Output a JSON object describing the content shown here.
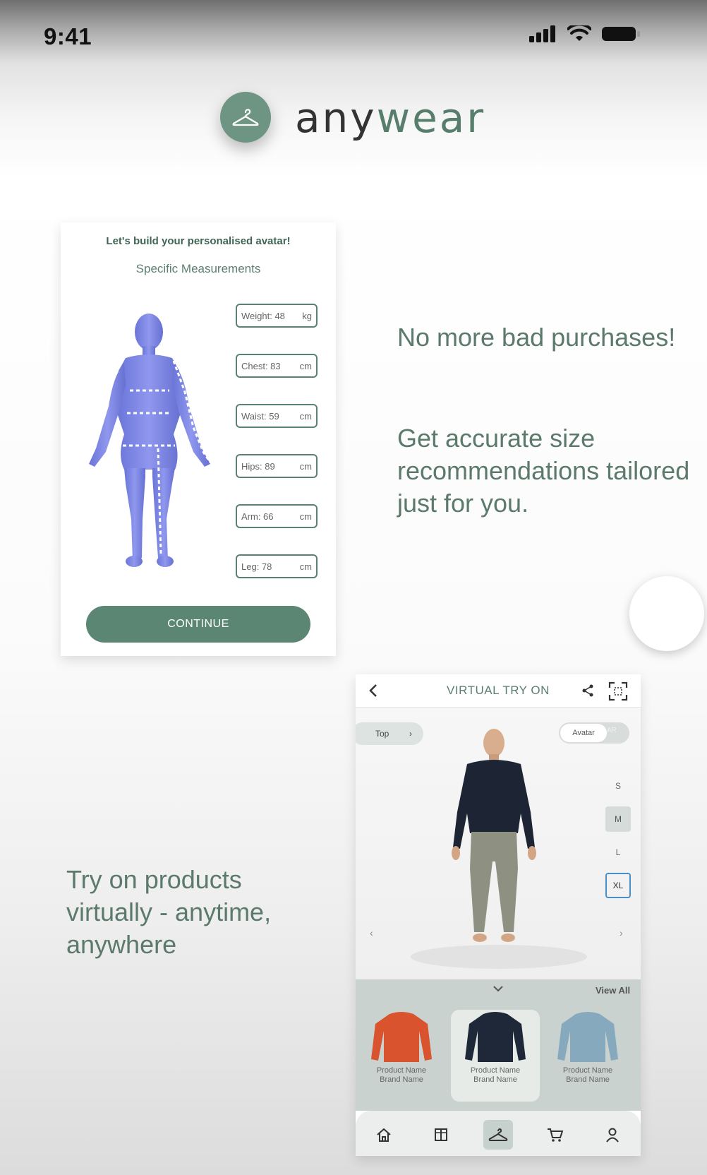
{
  "status_bar": {
    "time": "9:41"
  },
  "brand": {
    "prefix": "any",
    "accent": "wear"
  },
  "avatar_card": {
    "title": "Let's build your personalised avatar!",
    "subtitle": "Specific Measurements",
    "measurements": [
      {
        "label": "Weight: 48",
        "unit": "kg"
      },
      {
        "label": "Chest: 83",
        "unit": "cm"
      },
      {
        "label": "Waist: 59",
        "unit": "cm"
      },
      {
        "label": "Hips: 89",
        "unit": "cm"
      },
      {
        "label": "Arm: 66",
        "unit": "cm"
      },
      {
        "label": "Leg: 78",
        "unit": "cm"
      }
    ],
    "continue_label": "CONTINUE"
  },
  "promo": {
    "line1": "No more bad purchases!",
    "line2": "Get accurate size recommendations tailored just for you.",
    "line3": "Try on products virtually - anytime, anywhere"
  },
  "try_on": {
    "title": "VIRTUAL TRY ON",
    "category": "Top",
    "toggle_on": "Avatar",
    "toggle_off": "AR",
    "sizes": [
      "S",
      "M",
      "L",
      "XL"
    ],
    "selected_size": "M",
    "active_size": "XL",
    "view_all": "View All",
    "products": [
      {
        "name": "Product Name",
        "brand": "Brand Name",
        "color": "#d9532f"
      },
      {
        "name": "Product Name",
        "brand": "Brand Name",
        "color": "#1f2838"
      },
      {
        "name": "Product Name",
        "brand": "Brand Name",
        "color": "#86a9bd"
      }
    ],
    "nav": [
      "home-icon",
      "wardrobe-icon",
      "hanger-icon",
      "cart-icon",
      "profile-icon"
    ]
  },
  "colors": {
    "accent": "#5a8673",
    "text_green": "#5b7a6b"
  }
}
